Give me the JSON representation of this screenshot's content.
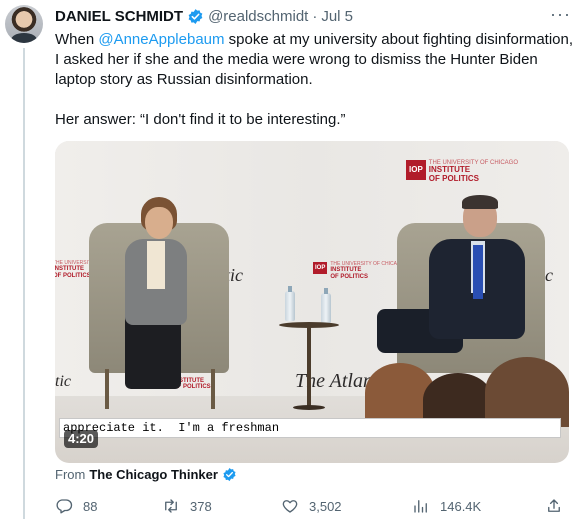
{
  "author": {
    "display_name": "DANIEL SCHMIDT",
    "handle": "@realdschmidt",
    "separator": "·",
    "date": "Jul 5"
  },
  "more_label": "···",
  "tweet": {
    "line_prefix": "When ",
    "mention": "@AnneApplebaum",
    "line_rest": " spoke at my university about fighting disinformation, I asked her if she and the media were wrong to dismiss the Hunter Biden laptop story as Russian disinformation.",
    "answer": "Her answer: “I don't find it to be interesting.”"
  },
  "video": {
    "caption": "appreciate it.  I'm a freshman",
    "duration": "4:20",
    "logo_box": "IOP",
    "logo_line1": "THE UNIVERSITY OF CHICAGO",
    "logo_line2": "INSTITUTE",
    "logo_line3": "OF POLITICS",
    "script_text_1": "tic",
    "script_text_2": "tic",
    "script_text_3": "tic",
    "script_text_4": "The Atlan"
  },
  "source": {
    "prefix": "From",
    "name": "The Chicago Thinker"
  },
  "actions": {
    "replies": "88",
    "retweets": "378",
    "likes": "3,502",
    "views": "146.4K"
  },
  "colors": {
    "accent": "#1d9bf0",
    "muted": "#536471",
    "text": "#0f1419",
    "brand_red": "#b11c2a"
  },
  "icons": [
    "verified-badge-icon",
    "more-icon",
    "reply-icon",
    "retweet-icon",
    "like-icon",
    "views-icon",
    "share-icon"
  ]
}
